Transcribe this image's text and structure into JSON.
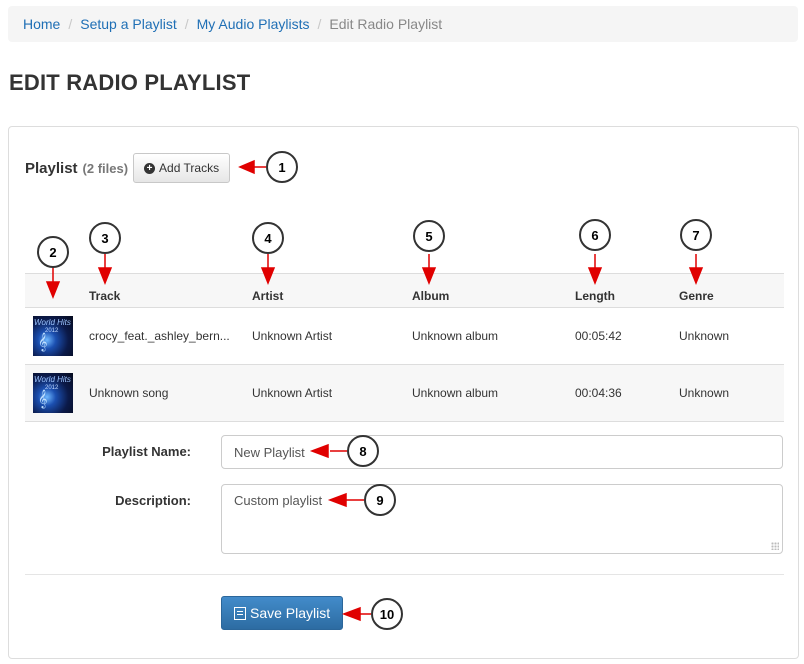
{
  "breadcrumb": [
    {
      "label": "Home",
      "link": true
    },
    {
      "label": "Setup a Playlist",
      "link": true
    },
    {
      "label": "My Audio Playlists",
      "link": true
    },
    {
      "label": "Edit Radio Playlist",
      "link": false
    }
  ],
  "page_title": "EDIT RADIO PLAYLIST",
  "playlist": {
    "title": "Playlist",
    "count_label": "(2 files)",
    "add_tracks_label": "Add Tracks"
  },
  "table": {
    "columns": [
      "",
      "Track",
      "Artist",
      "Album",
      "Length",
      "Genre"
    ],
    "rows": [
      {
        "art": "World Hits 2012",
        "track": "crocy_feat._ashley_bern...",
        "artist": "Unknown Artist",
        "album": "Unknown album",
        "length": "00:05:42",
        "genre": "Unknown"
      },
      {
        "art": "World Hits 2012",
        "track": "Unknown song",
        "artist": "Unknown Artist",
        "album": "Unknown album",
        "length": "00:04:36",
        "genre": "Unknown"
      }
    ]
  },
  "form": {
    "name_label": "Playlist Name:",
    "name_value": "New Playlist",
    "description_label": "Description:",
    "description_value": "Custom playlist",
    "save_label": "Save Playlist"
  },
  "callouts": [
    "1",
    "2",
    "3",
    "4",
    "5",
    "6",
    "7",
    "8",
    "9",
    "10"
  ],
  "colors": {
    "link": "#1f6fb5",
    "primary": "#428bca",
    "annotation_arrow": "#e00000"
  }
}
